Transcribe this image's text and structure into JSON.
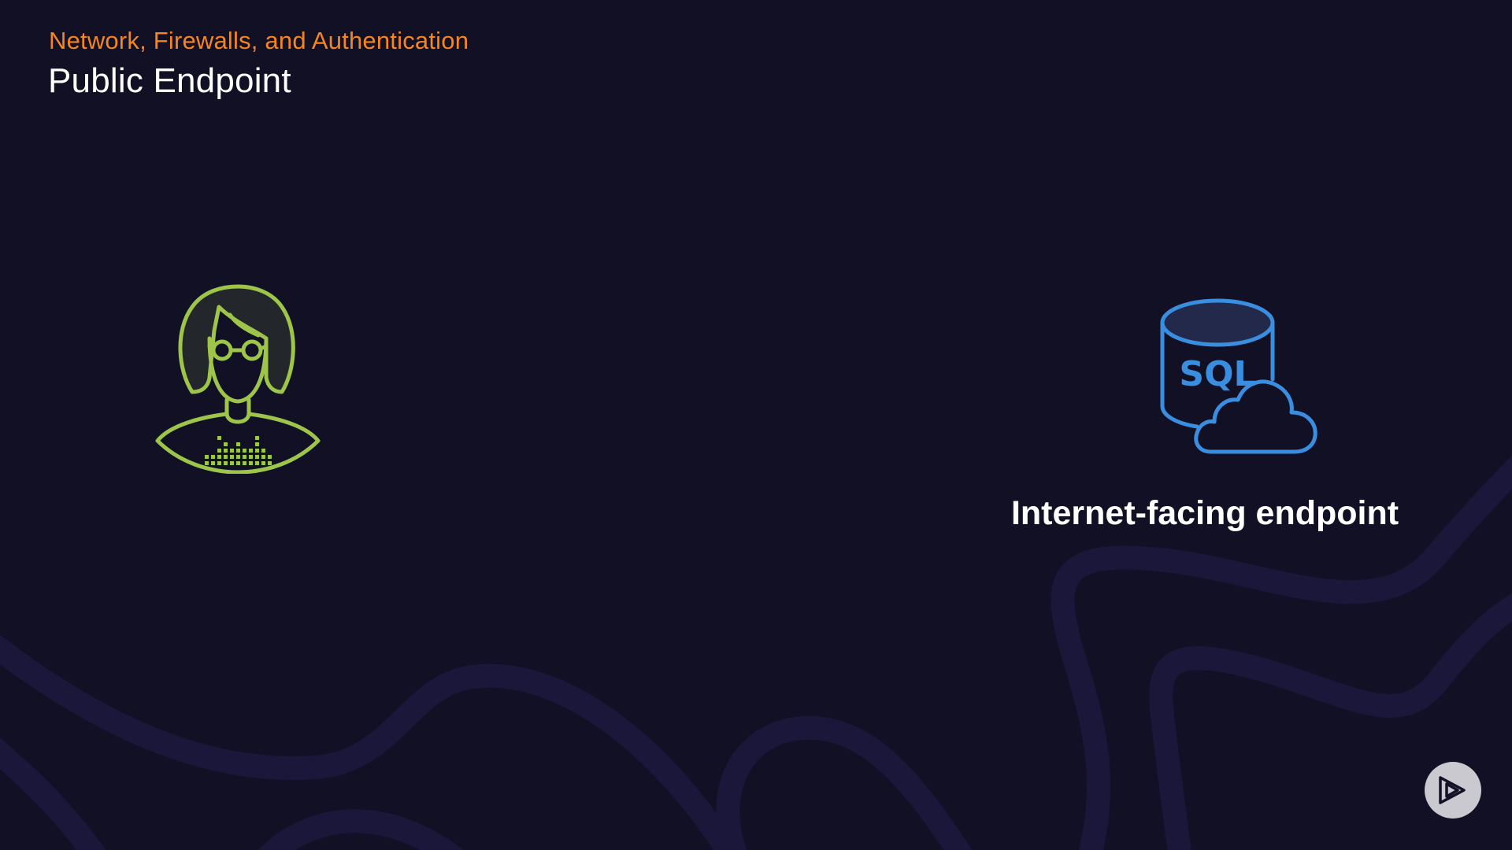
{
  "header": {
    "subtitle": "Network, Firewalls, and Authentication",
    "title": "Public Endpoint"
  },
  "diagram": {
    "user_icon": "user-with-glasses-icon",
    "database_icon": "sql-cloud-database-icon",
    "database_icon_text": "SQL",
    "endpoint_label": "Internet-facing endpoint"
  },
  "player": {
    "play_icon": "play-logo-icon"
  },
  "colors": {
    "background": "#121025",
    "accent_orange": "#f6851f",
    "user_green": "#9cc54a",
    "db_blue": "#3a8ee0",
    "wave": "#1b173a"
  }
}
